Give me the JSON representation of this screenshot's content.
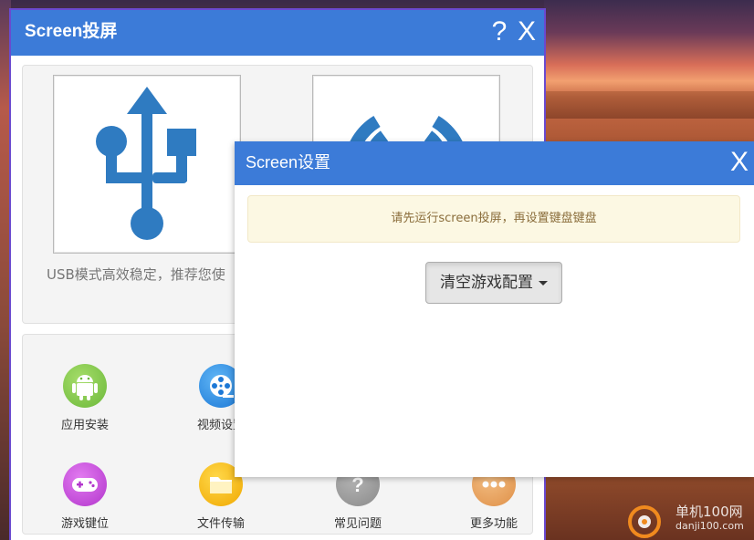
{
  "main_window": {
    "title": "Screen投屏",
    "help_label": "?",
    "close_label": "X",
    "usb_description": "USB模式高效稳定，推荐您使",
    "tools": [
      {
        "label": "应用安装",
        "icon": "android-icon",
        "color": "#7cc24a"
      },
      {
        "label": "视频设置",
        "icon": "film-reel-icon",
        "color": "#2f8fe6"
      },
      {
        "label": "游戏键位",
        "icon": "gamepad-icon",
        "color": "#c44ad9"
      },
      {
        "label": "文件传输",
        "icon": "folder-icon",
        "color": "#f5b914"
      },
      {
        "label": "常见问题",
        "icon": "question-icon",
        "color": "#9a9a9a"
      },
      {
        "label": "更多功能",
        "icon": "more-dots-icon",
        "color": "#e8a25a"
      }
    ],
    "colors": {
      "titlebar": "#3c7bd8",
      "usb_icon": "#2f7bc1"
    }
  },
  "settings_dialog": {
    "title": "Screen设置",
    "close_label": "X",
    "notice": "请先运行screen投屏，再设置键盘键盘",
    "clear_button_label": "清空游戏配置"
  },
  "watermark": {
    "text": "单机100网",
    "sub": "danji100.com"
  }
}
